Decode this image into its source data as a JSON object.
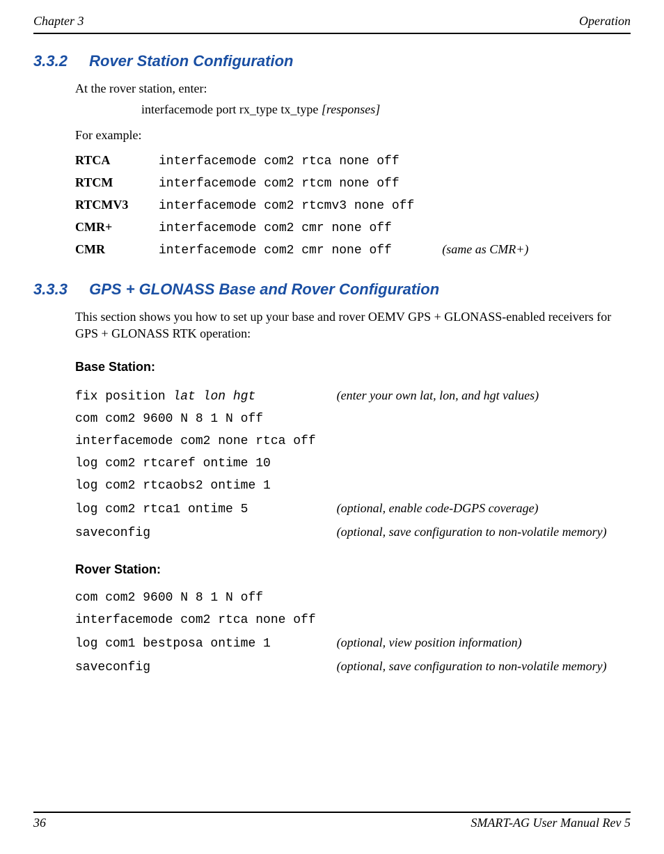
{
  "header": {
    "left": "Chapter 3",
    "right": "Operation"
  },
  "section_332": {
    "number": "3.3.2",
    "title": "Rover Station Configuration",
    "intro1": "At the rover station, enter:",
    "syntax_pre": "interfacemode port rx_type tx_type ",
    "syntax_ital": "[responses]",
    "intro2": "For example:",
    "rows": [
      {
        "key": "RTCA",
        "cmd": "interfacemode com2 rtca none off",
        "note": ""
      },
      {
        "key": "RTCM",
        "cmd": "interfacemode com2 rtcm none off",
        "note": ""
      },
      {
        "key": "RTCMV3",
        "cmd": "interfacemode com2 rtcmv3 none off",
        "note": ""
      },
      {
        "key": "CMR+",
        "cmd": "interfacemode com2 cmr none off",
        "note": ""
      },
      {
        "key": "CMR",
        "cmd": "interfacemode com2 cmr none off",
        "note": "(same as CMR+)"
      }
    ]
  },
  "section_333": {
    "number": "3.3.3",
    "title": "GPS + GLONASS Base and Rover Configuration",
    "intro": "This section shows you how to set up your base and rover OEMV GPS + GLONASS-enabled receivers for GPS + GLONASS RTK operation:",
    "base_heading": "Base Station:",
    "base_rows": [
      {
        "cmd_pre": "fix position ",
        "cmd_ital": "lat lon hgt",
        "note": "(enter your own lat, lon, and hgt values)"
      },
      {
        "cmd_pre": "com com2 9600 N 8 1 N off",
        "cmd_ital": "",
        "note": ""
      },
      {
        "cmd_pre": "interfacemode com2 none rtca off",
        "cmd_ital": "",
        "note": ""
      },
      {
        "cmd_pre": "log com2 rtcaref ontime 10",
        "cmd_ital": "",
        "note": ""
      },
      {
        "cmd_pre": "log com2 rtcaobs2 ontime 1",
        "cmd_ital": "",
        "note": ""
      },
      {
        "cmd_pre": "log com2 rtca1 ontime 5",
        "cmd_ital": "",
        "note": "(optional, enable code-DGPS coverage)"
      },
      {
        "cmd_pre": "saveconfig",
        "cmd_ital": "",
        "note": "(optional, save configuration to non-volatile memory)"
      }
    ],
    "rover_heading": "Rover Station:",
    "rover_rows": [
      {
        "cmd_pre": "com com2 9600 N 8 1 N off",
        "cmd_ital": "",
        "note": ""
      },
      {
        "cmd_pre": "interfacemode com2 rtca none off",
        "cmd_ital": "",
        "note": ""
      },
      {
        "cmd_pre": "log com1 bestposa ontime 1",
        "cmd_ital": "",
        "note": "(optional, view position information)"
      },
      {
        "cmd_pre": "saveconfig",
        "cmd_ital": "",
        "note": "(optional, save configuration to non-volatile memory)"
      }
    ]
  },
  "footer": {
    "page": "36",
    "doc": "SMART-AG User Manual Rev 5"
  }
}
